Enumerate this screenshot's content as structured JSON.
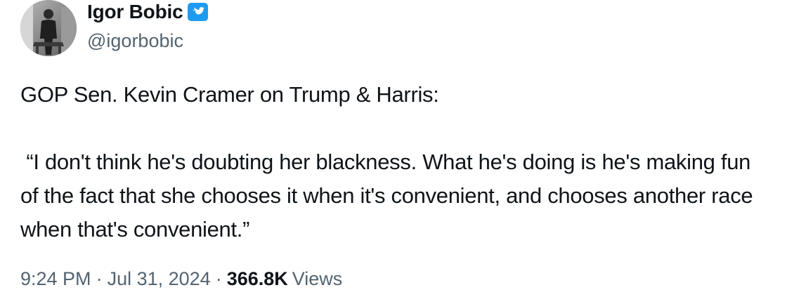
{
  "author": {
    "display_name": "Igor Bobic",
    "handle": "@igorbobic",
    "verified_icon": "verified-badge-icon",
    "avatar_icon": "profile-photo"
  },
  "tweet": {
    "text": "GOP Sen. Kevin Cramer on Trump & Harris:\n\n “I don't think he's doubting her blackness. What he's doing is he's making fun of the fact that she chooses it when it's convenient, and chooses another race when that's convenient.”"
  },
  "meta": {
    "time": "9:24 PM",
    "separator": "·",
    "date": "Jul 31, 2024",
    "views_count": "366.8K",
    "views_label": "Views"
  },
  "colors": {
    "text_primary": "#0f1419",
    "text_secondary": "#536471",
    "verified_blue": "#1d9bf0"
  }
}
